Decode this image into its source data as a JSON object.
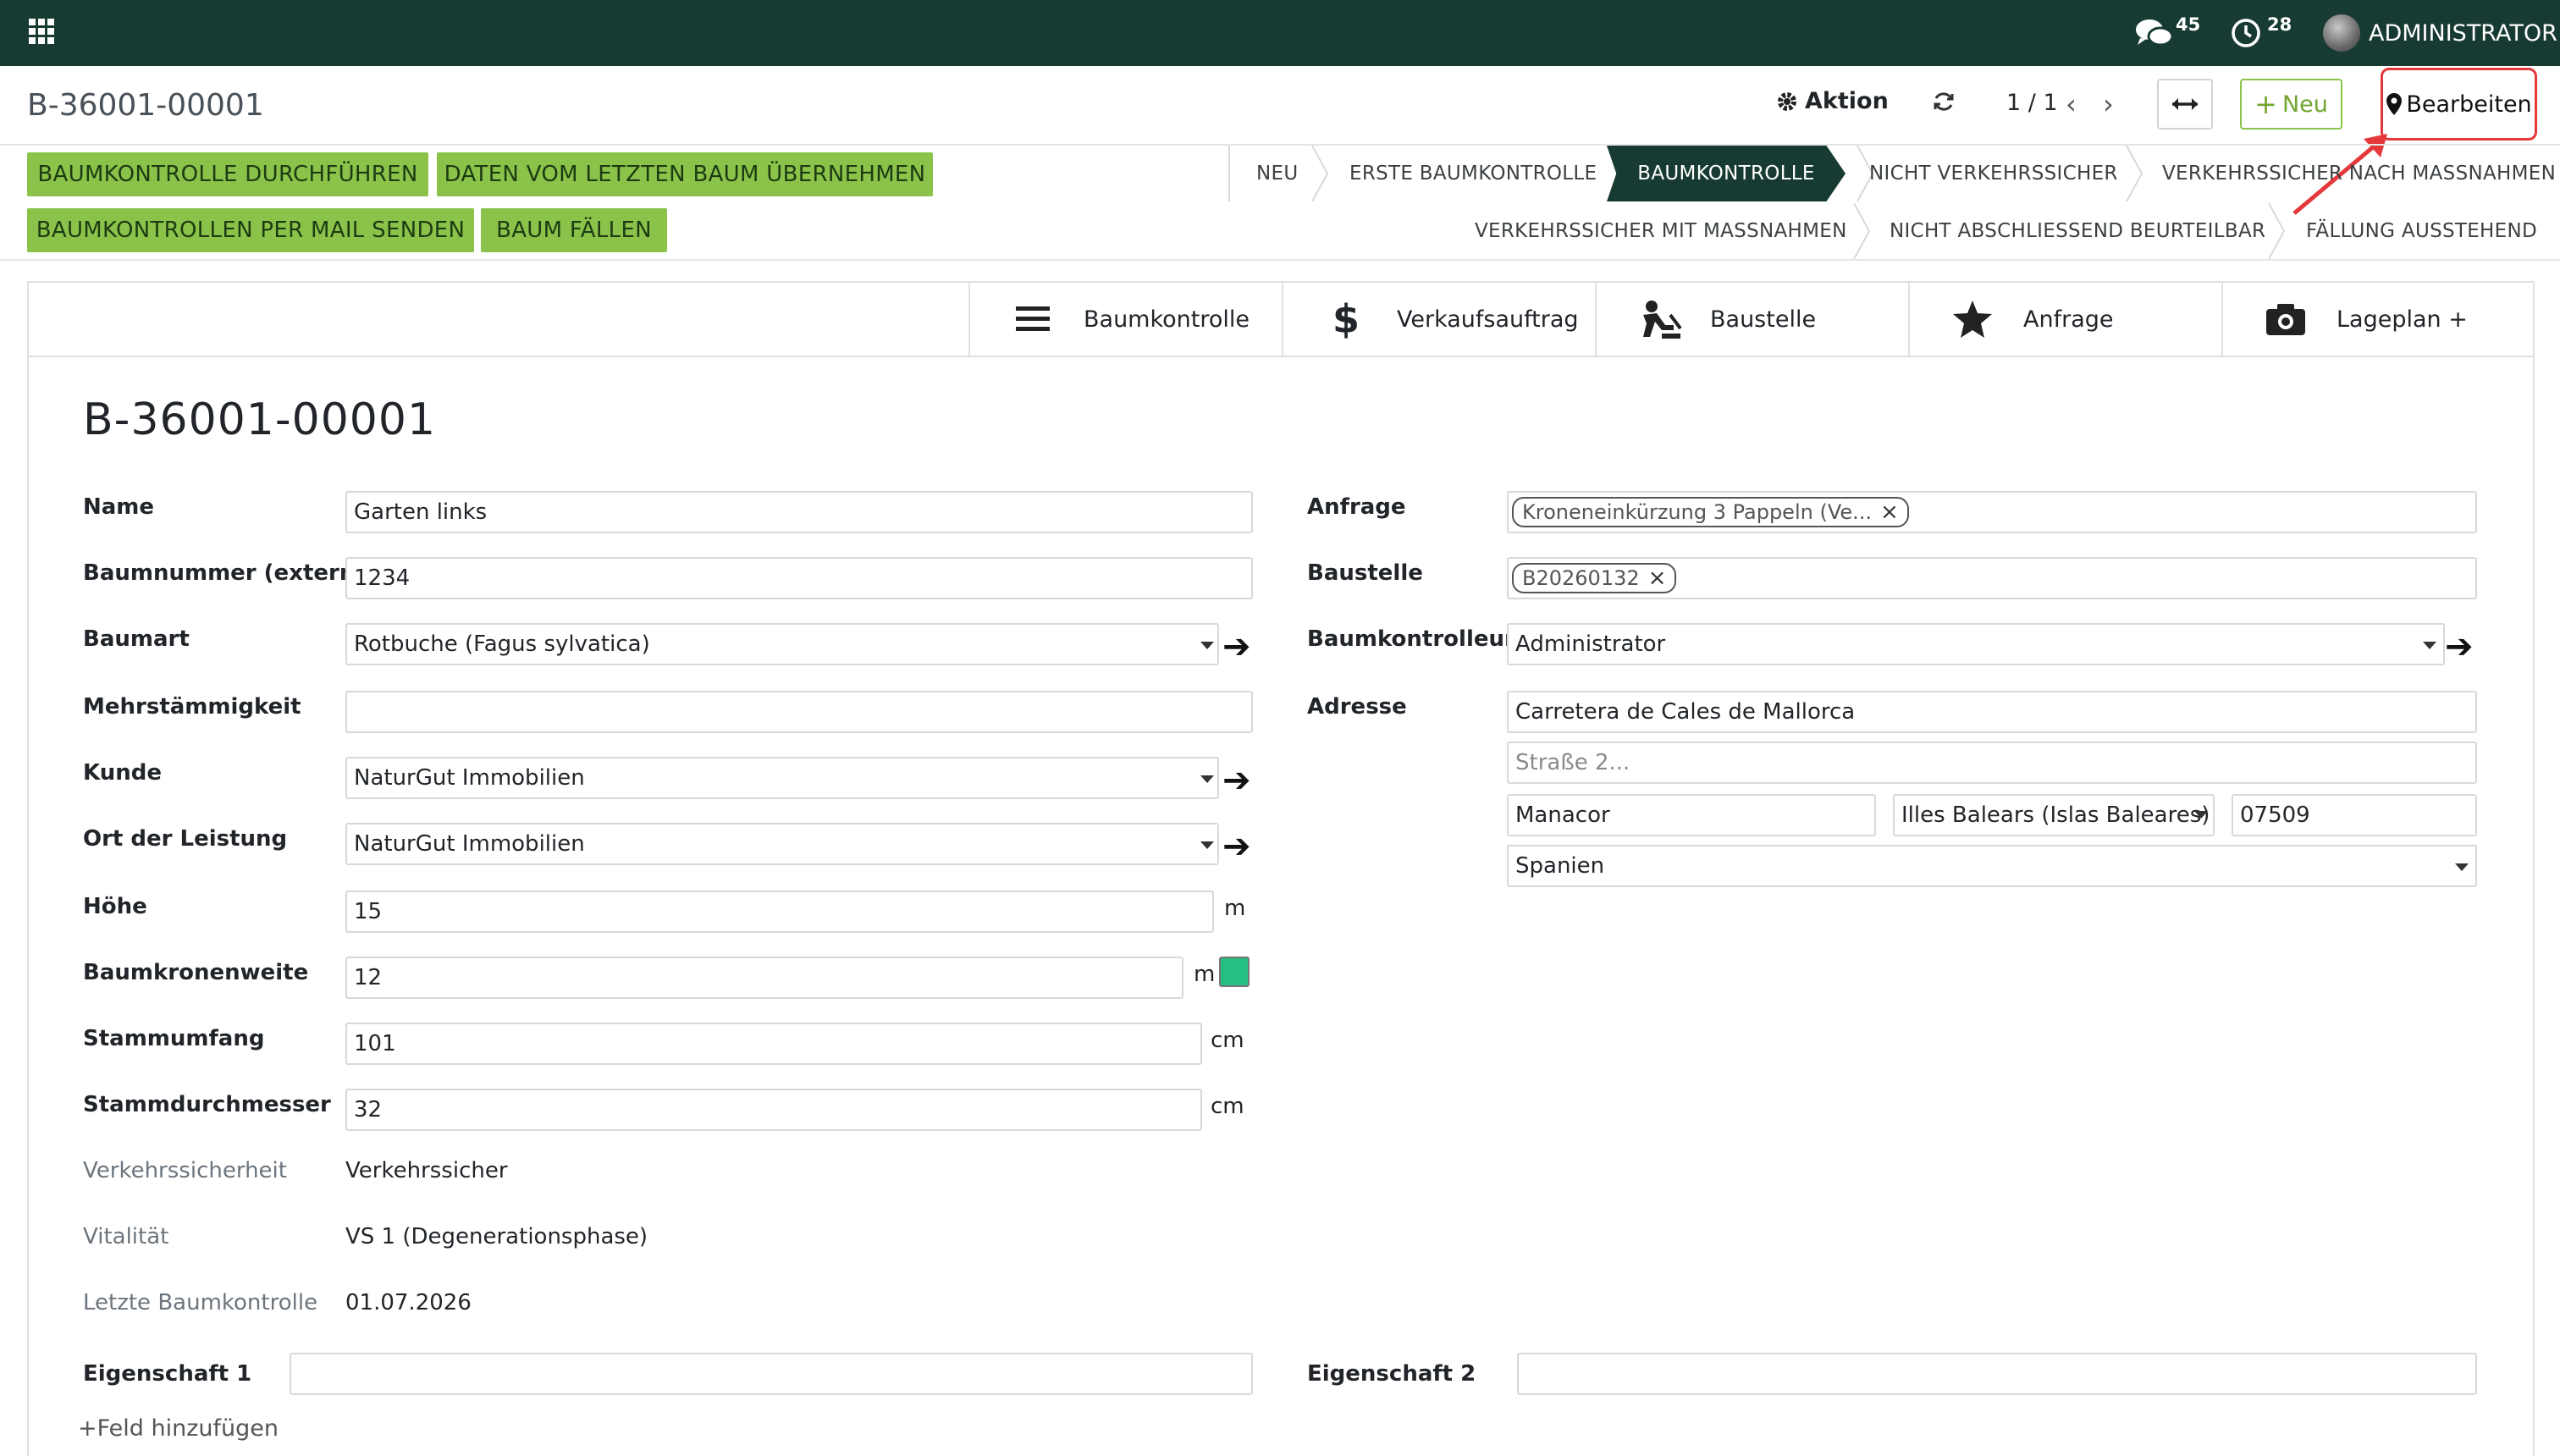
{
  "topbar": {
    "apps_icon": "grid-icon",
    "messages_count": "45",
    "activities_count": "28",
    "user_name": "ADMINISTRATOR"
  },
  "control_panel": {
    "breadcrumb": "B-36001-00001",
    "action_label": "Aktion",
    "pager": "1 / 1",
    "new_label": "Neu",
    "edit_label": "Bearbeiten"
  },
  "action_buttons": [
    "BAUMKONTROLLE DURCHFÜHREN",
    "DATEN VOM LETZTEN BAUM ÜBERNEHMEN",
    "BAUMKONTROLLEN PER MAIL SENDEN",
    "BAUM FÄLLEN"
  ],
  "stages": {
    "row1": [
      "NEU",
      "ERSTE BAUMKONTROLLE",
      "BAUMKONTROLLE",
      "NICHT VERKEHRSSICHER",
      "VERKEHRSSICHER NACH MASSNAHMEN"
    ],
    "row2": [
      "VERKEHRSSICHER MIT MASSNAHMEN",
      "NICHT ABSCHLIESSEND BEURTEILBAR",
      "FÄLLUNG AUSSTEHEND"
    ],
    "active": "BAUMKONTROLLE"
  },
  "smart_buttons": [
    {
      "label": "Baumkontrolle",
      "icon": "list-icon"
    },
    {
      "label": "Verkaufsauftrag",
      "icon": "dollar-icon"
    },
    {
      "label": "Baustelle",
      "icon": "worker-icon"
    },
    {
      "label": "Anfrage",
      "icon": "star-icon"
    },
    {
      "label": "Lageplan +",
      "icon": "camera-icon"
    }
  ],
  "record_title": "B-36001-00001",
  "left_fields": {
    "name": {
      "label": "Name",
      "value": "Garten links"
    },
    "baumnummer": {
      "label": "Baumnummer (extern)",
      "value": "1234"
    },
    "baumart": {
      "label": "Baumart",
      "value": "Rotbuche (Fagus sylvatica)"
    },
    "mehrstaemmigkeit": {
      "label": "Mehrstämmigkeit",
      "value": ""
    },
    "kunde": {
      "label": "Kunde",
      "value": "NaturGut Immobilien"
    },
    "ort": {
      "label": "Ort der Leistung",
      "value": "NaturGut Immobilien"
    },
    "hoehe": {
      "label": "Höhe",
      "value": "15",
      "unit": "m"
    },
    "kronenweite": {
      "label": "Baumkronenweite",
      "value": "12",
      "unit": "m",
      "color": "#25c081"
    },
    "stammumfang": {
      "label": "Stammumfang",
      "value": "101",
      "unit": "cm"
    },
    "stammdurchmesser": {
      "label": "Stammdurchmesser",
      "value": "32",
      "unit": "cm"
    },
    "verkehrssicherheit": {
      "label": "Verkehrssicherheit",
      "value": "Verkehrssicher"
    },
    "vitalitaet": {
      "label": "Vitalität",
      "value": "VS 1 (Degenerationsphase)"
    },
    "letzte": {
      "label": "Letzte Baumkontrolle",
      "value": "01.07.2026"
    }
  },
  "right_fields": {
    "anfrage": {
      "label": "Anfrage",
      "tag": "Kroneneinkürzung 3 Pappeln (Ve..."
    },
    "baustelle": {
      "label": "Baustelle",
      "tag": "B20260132"
    },
    "kontrolleur": {
      "label": "Baumkontrolleur",
      "value": "Administrator"
    },
    "adresse": {
      "label": "Adresse",
      "street": "Carretera de Cales de Mallorca",
      "street2_placeholder": "Straße 2...",
      "city": "Manacor",
      "state": "Illes Balears (Islas Baleares)",
      "zip": "07509",
      "country": "Spanien"
    }
  },
  "properties": {
    "eigenschaft1": {
      "label": "Eigenschaft 1",
      "value": ""
    },
    "eigenschaft2": {
      "label": "Eigenschaft 2",
      "value": ""
    },
    "add_field": "Feld hinzufügen"
  }
}
